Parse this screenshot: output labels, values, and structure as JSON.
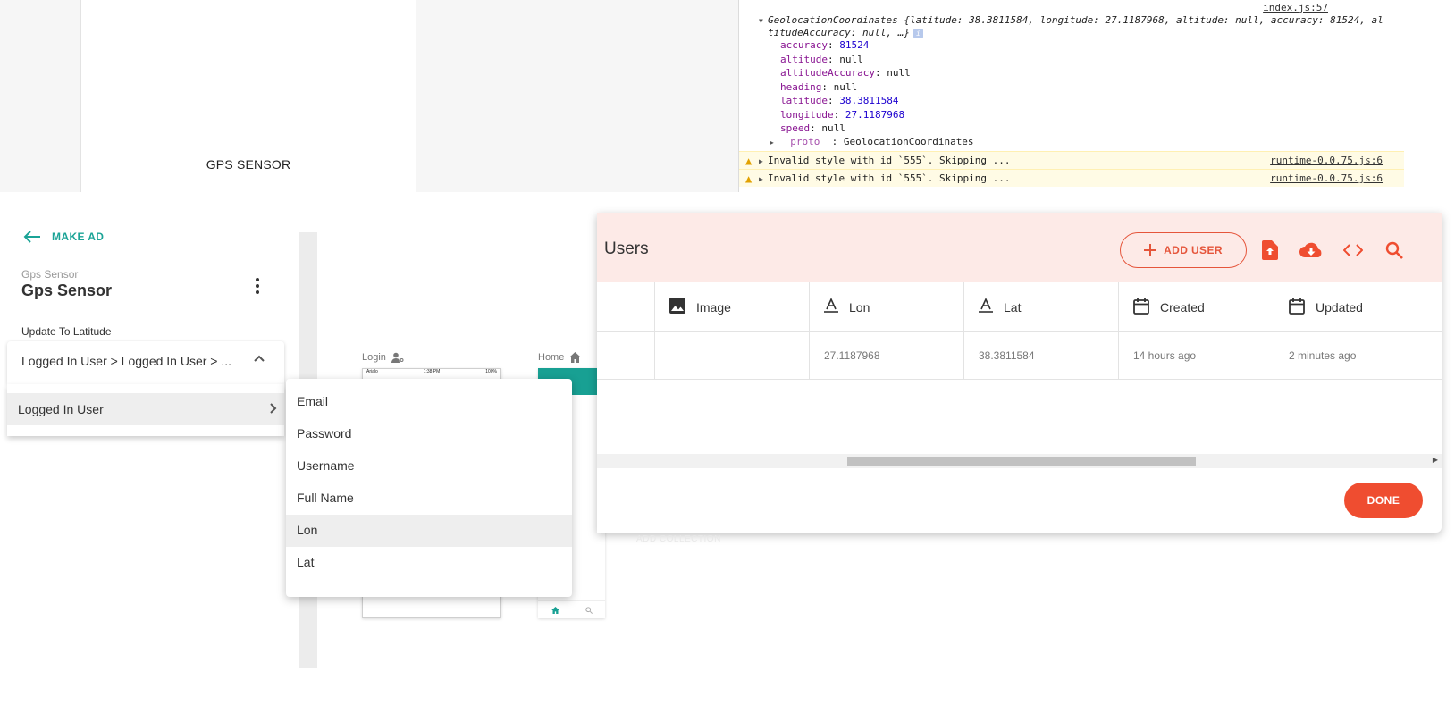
{
  "preview": {
    "label": "GPS SENSOR"
  },
  "console": {
    "source_top": "index.js:57",
    "obj_line1": "GeolocationCoordinates {latitude: 38.3811584, longitude: 27.1187968, altitude: null, accuracy: 81524, al",
    "obj_line2": "titudeAccuracy: null, …}",
    "props": [
      {
        "key": "accuracy",
        "value": "81524",
        "numeric": true
      },
      {
        "key": "altitude",
        "value": "null",
        "numeric": false
      },
      {
        "key": "altitudeAccuracy",
        "value": "null",
        "numeric": false
      },
      {
        "key": "heading",
        "value": "null",
        "numeric": false
      },
      {
        "key": "latitude",
        "value": "38.3811584",
        "numeric": true
      },
      {
        "key": "longitude",
        "value": "27.1187968",
        "numeric": true
      },
      {
        "key": "speed",
        "value": "null",
        "numeric": false
      }
    ],
    "proto_key": "__proto__",
    "proto_value": "GeolocationCoordinates",
    "warnings": [
      {
        "text": "Invalid style with id `555`. Skipping ...",
        "source": "runtime-0.0.75.js:6"
      },
      {
        "text": "Invalid style with id `555`. Skipping ...",
        "source": "runtime-0.0.75.js:6"
      }
    ]
  },
  "sidebar": {
    "back_label": "MAKE AD",
    "subtitle": "Gps Sensor",
    "title": "Gps Sensor",
    "field_label": "Update To Latitude",
    "select_value": "Logged In User > Logged In User > ...",
    "menu_item": "Logged In User"
  },
  "canvas": {
    "login_label": "Login",
    "home_label": "Home",
    "status_carrier": "Arialo",
    "status_time": "1:38 PM",
    "status_battery": "100%"
  },
  "submenu": {
    "items": [
      "Email",
      "Password",
      "Username",
      "Full Name",
      "Lon",
      "Lat"
    ],
    "active_index": 4
  },
  "users": {
    "title": "Users",
    "add_user_label": "ADD USER",
    "columns": [
      {
        "label": "Image",
        "icon": "image-icon"
      },
      {
        "label": "Lon",
        "icon": "text-icon"
      },
      {
        "label": "Lat",
        "icon": "text-icon"
      },
      {
        "label": "Created",
        "icon": "calendar-icon"
      },
      {
        "label": "Updated",
        "icon": "calendar-icon"
      }
    ],
    "rows": [
      {
        "image": "",
        "lon": "27.1187968",
        "lat": "38.3811584",
        "created": "14 hours ago",
        "updated": "2 minutes ago"
      }
    ],
    "done_label": "DONE"
  },
  "ghost_text": "ADD COLLECTION",
  "colors": {
    "accent_teal": "#1aa396",
    "accent_red": "#ef4d30",
    "header_pink": "#fdeae7"
  }
}
